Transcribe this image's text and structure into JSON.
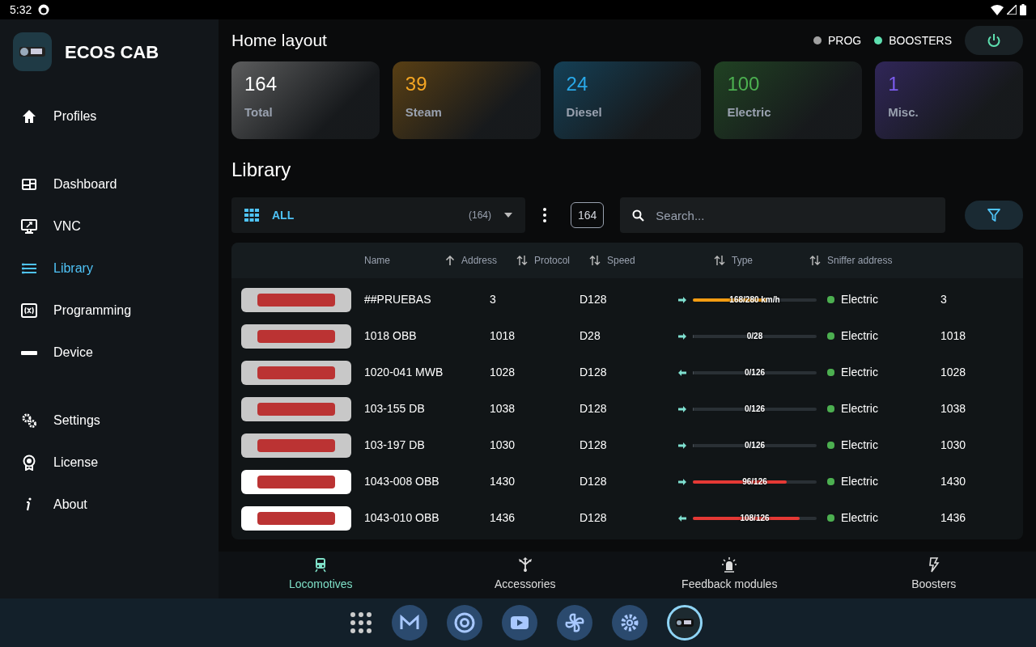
{
  "status_bar": {
    "time": "5:32"
  },
  "app": {
    "title": "ECOS CAB"
  },
  "sidebar": {
    "sections": [
      [
        {
          "label": "Profiles",
          "selected": false
        }
      ],
      [
        {
          "label": "Dashboard",
          "selected": false
        },
        {
          "label": "VNC",
          "selected": false
        },
        {
          "label": "Library",
          "selected": true
        },
        {
          "label": "Programming",
          "selected": false
        },
        {
          "label": "Device",
          "selected": false
        }
      ],
      [
        {
          "label": "Settings",
          "selected": false
        },
        {
          "label": "License",
          "selected": false
        },
        {
          "label": "About",
          "selected": false
        }
      ]
    ]
  },
  "header": {
    "title": "Home layout",
    "indicators": [
      {
        "label": "PROG",
        "color": "#a0a0a0"
      },
      {
        "label": "BOOSTERS",
        "color": "#5ee0b0"
      }
    ]
  },
  "stats": [
    {
      "value": "164",
      "label": "Total",
      "color": "#ffffff"
    },
    {
      "value": "39",
      "label": "Steam",
      "color": "#f5a623"
    },
    {
      "value": "24",
      "label": "Diesel",
      "color": "#29a8e8"
    },
    {
      "value": "100",
      "label": "Electric",
      "color": "#4caf50"
    },
    {
      "value": "1",
      "label": "Misc.",
      "color": "#7c5cf0"
    }
  ],
  "library": {
    "title": "Library",
    "filter": {
      "label": "ALL",
      "count": "(164)"
    },
    "total": "164",
    "search": {
      "placeholder": "Search..."
    }
  },
  "table": {
    "columns": [
      "Name",
      "Address",
      "Protocol",
      "Speed",
      "Type",
      "Sniffer address"
    ],
    "rows": [
      {
        "name": "##PRUEBAS",
        "address": "3",
        "protocol": "D128",
        "reverse": false,
        "level": 0.6,
        "reading": "168/280 km/h",
        "color": "#f39c12",
        "type": "Electric",
        "sniffer": "3"
      },
      {
        "name": "1018 OBB",
        "address": "1018",
        "protocol": "D28",
        "reverse": false,
        "level": 0,
        "reading": "0/28",
        "type": "Electric",
        "sniffer": "1018"
      },
      {
        "name": "1020-041 MWB",
        "address": "1028",
        "protocol": "D128",
        "reverse": true,
        "level": 0,
        "reading": "0/126",
        "type": "Electric",
        "sniffer": "1028"
      },
      {
        "name": "103-155 DB",
        "address": "1038",
        "protocol": "D128",
        "reverse": false,
        "level": 0,
        "reading": "0/126",
        "type": "Electric",
        "sniffer": "1038"
      },
      {
        "name": "103-197 DB",
        "address": "1030",
        "protocol": "D128",
        "reverse": false,
        "level": 0,
        "reading": "0/126",
        "type": "Electric",
        "sniffer": "1030"
      },
      {
        "name": "1043-008 OBB",
        "address": "1430",
        "protocol": "D128",
        "reverse": false,
        "level": 0.76,
        "reading": "96/126",
        "color": "#e53935",
        "type": "Electric",
        "sniffer": "1430"
      },
      {
        "name": "1043-010 OBB",
        "address": "1436",
        "protocol": "D128",
        "reverse": true,
        "level": 0.86,
        "reading": "108/126",
        "color": "#e53935",
        "type": "Electric",
        "sniffer": "1436"
      }
    ]
  },
  "bottom_nav": [
    {
      "label": "Locomotives",
      "selected": true
    },
    {
      "label": "Accessories",
      "selected": false
    },
    {
      "label": "Feedback modules",
      "selected": false
    },
    {
      "label": "Boosters",
      "selected": false
    }
  ]
}
